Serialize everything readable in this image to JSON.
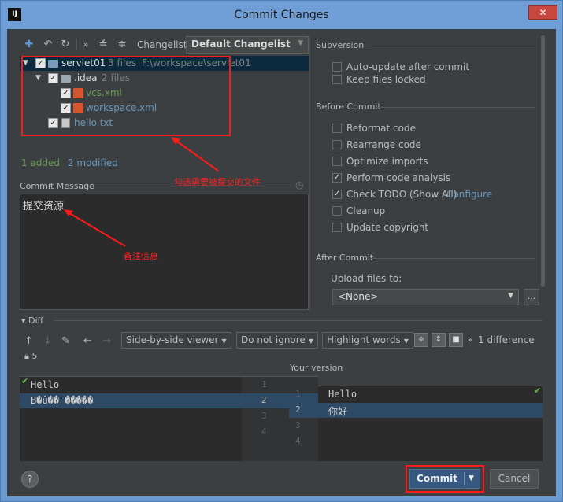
{
  "window": {
    "title": "Commit Changes",
    "app_icon": "IJ",
    "close_glyph": "✕"
  },
  "toolbar": {
    "changelist_label": "Changelist:",
    "changelist_value": "Default Changelist"
  },
  "tree": {
    "root": {
      "name": "servlet01",
      "meta": "3 files",
      "path": "F:\\workspace\\servlet01"
    },
    "idea": {
      "name": ".idea",
      "meta": "2 files"
    },
    "files": [
      "vcs.xml",
      "workspace.xml",
      "hello.txt"
    ]
  },
  "stats": {
    "added": "1 added",
    "modified": "2 modified"
  },
  "annotations": {
    "tree": "勾选需要被提交的文件",
    "message": "备注信息"
  },
  "commit_message": {
    "label": "Commit Message",
    "text": "提交资源"
  },
  "options": {
    "subversion_title": "Subversion",
    "auto_update": "Auto-update after commit",
    "keep_locked": "Keep files locked",
    "before_commit_title": "Before Commit",
    "reformat": "Reformat code",
    "rearrange": "Rearrange code",
    "optimize": "Optimize imports",
    "analysis": "Perform code analysis",
    "todo": "Check TODO (Show All)",
    "configure": "Configure",
    "cleanup": "Cleanup",
    "copyright": "Update copyright",
    "after_commit_title": "After Commit",
    "upload_label": "Upload files to:",
    "upload_value": "<None>",
    "upload_more": "..."
  },
  "diff": {
    "title": "Diff",
    "viewer": "Side-by-side viewer",
    "ignore": "Do not ignore",
    "highlight": "Highlight words",
    "difference": "1 difference",
    "lock_count": "5",
    "your_version": "Your version",
    "left_lines": [
      "Hello",
      "B�û�� �����"
    ],
    "right_lines": [
      "Hello",
      "你好"
    ],
    "left_nums": [
      "1",
      "2",
      "3",
      "4"
    ],
    "right_nums": [
      "1",
      "2",
      "3",
      "4"
    ]
  },
  "buttons": {
    "help": "?",
    "commit": "Commit",
    "cancel": "Cancel"
  }
}
